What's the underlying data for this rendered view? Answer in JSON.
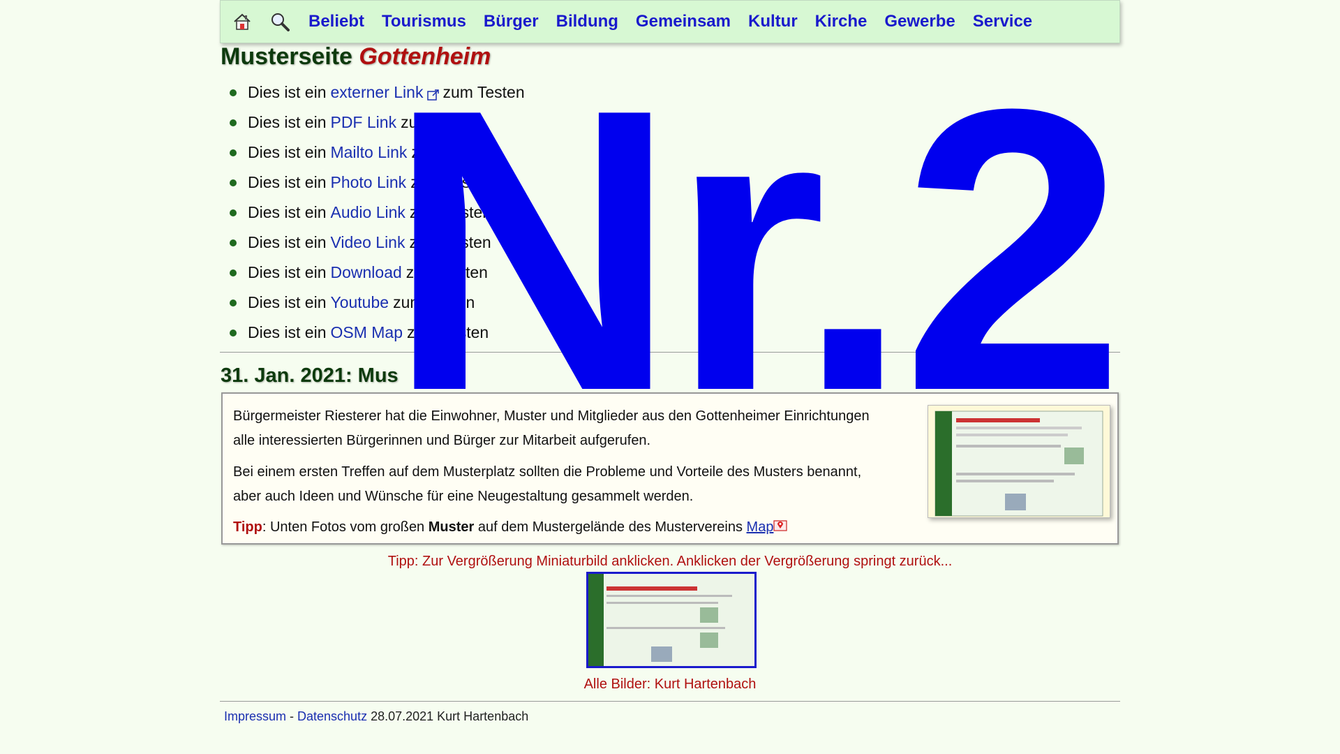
{
  "nav": {
    "home_icon": "home-icon",
    "search_icon": "search-icon",
    "items": [
      "Beliebt",
      "Tourismus",
      "Bürger",
      "Bildung",
      "Gemeinsam",
      "Kultur",
      "Kirche",
      "Gewerbe",
      "Service"
    ]
  },
  "title": {
    "prefix": "Musterseite",
    "brand": "Gottenheim"
  },
  "links": [
    {
      "before": "Dies ist ein",
      "link": "externer Link",
      "after": "zum Testen"
    },
    {
      "before": "Dies ist ein",
      "link": "PDF Link",
      "after": "zum Testen"
    },
    {
      "before": "Dies ist ein",
      "link": "Mailto Link",
      "after": "zum Testen"
    },
    {
      "before": "Dies ist ein",
      "link": "Photo Link",
      "after": "zum Testen"
    },
    {
      "before": "Dies ist ein",
      "link": "Audio Link",
      "after": "zum Testen"
    },
    {
      "before": "Dies ist ein",
      "link": "Video Link",
      "after": "zum Testen"
    },
    {
      "before": "Dies ist ein",
      "link": "Download",
      "after": "zum Testen"
    },
    {
      "before": "Dies ist ein",
      "link": "Youtube",
      "after": "zum Testen"
    },
    {
      "before": "Dies ist ein",
      "link": "OSM Map",
      "after": "zum Testen"
    }
  ],
  "section": {
    "title": "31. Jan. 2021: Mus",
    "para1_line1": "Bürgermeister Riesterer hat die Einwohner, Muster und Mitglieder aus den Gottenheimer Einrichtungen",
    "para1_line2": "alle interessierten Bürgerinnen und Bürger zur Mitarbeit aufgerufen.",
    "para2_line1": "Bei einem ersten Treffen auf dem Musterplatz sollten die Probleme und Vorteile des Musters benannt,",
    "para2_line2": "aber auch Ideen und Wünsche für eine Neugestaltung gesammelt werden.",
    "tip_label": "Tipp",
    "tip_text1": ": Unten Fotos vom großen ",
    "tip_bold": "Muster",
    "tip_text2": " auf dem Mustergelände des Mustervereins ",
    "tip_link": "Map"
  },
  "gallery": {
    "hint": "Tipp: Zur Vergrößerung Miniaturbild anklicken. Anklicken der Vergrößerung springt zurück...",
    "credit": "Alle Bilder: Kurt Hartenbach"
  },
  "footer": {
    "impressum": "Impressum",
    "sep": " - ",
    "datenschutz": "Datenschutz",
    "date": " 28.07.2021 Kurt Hartenbach"
  },
  "overlay": {
    "text": "Nr.2"
  },
  "colors": {
    "nav_bg": "#d7f8d3",
    "link": "#1a2fb0",
    "accent_red": "#b01010",
    "overlay_blue": "#0000ee"
  }
}
